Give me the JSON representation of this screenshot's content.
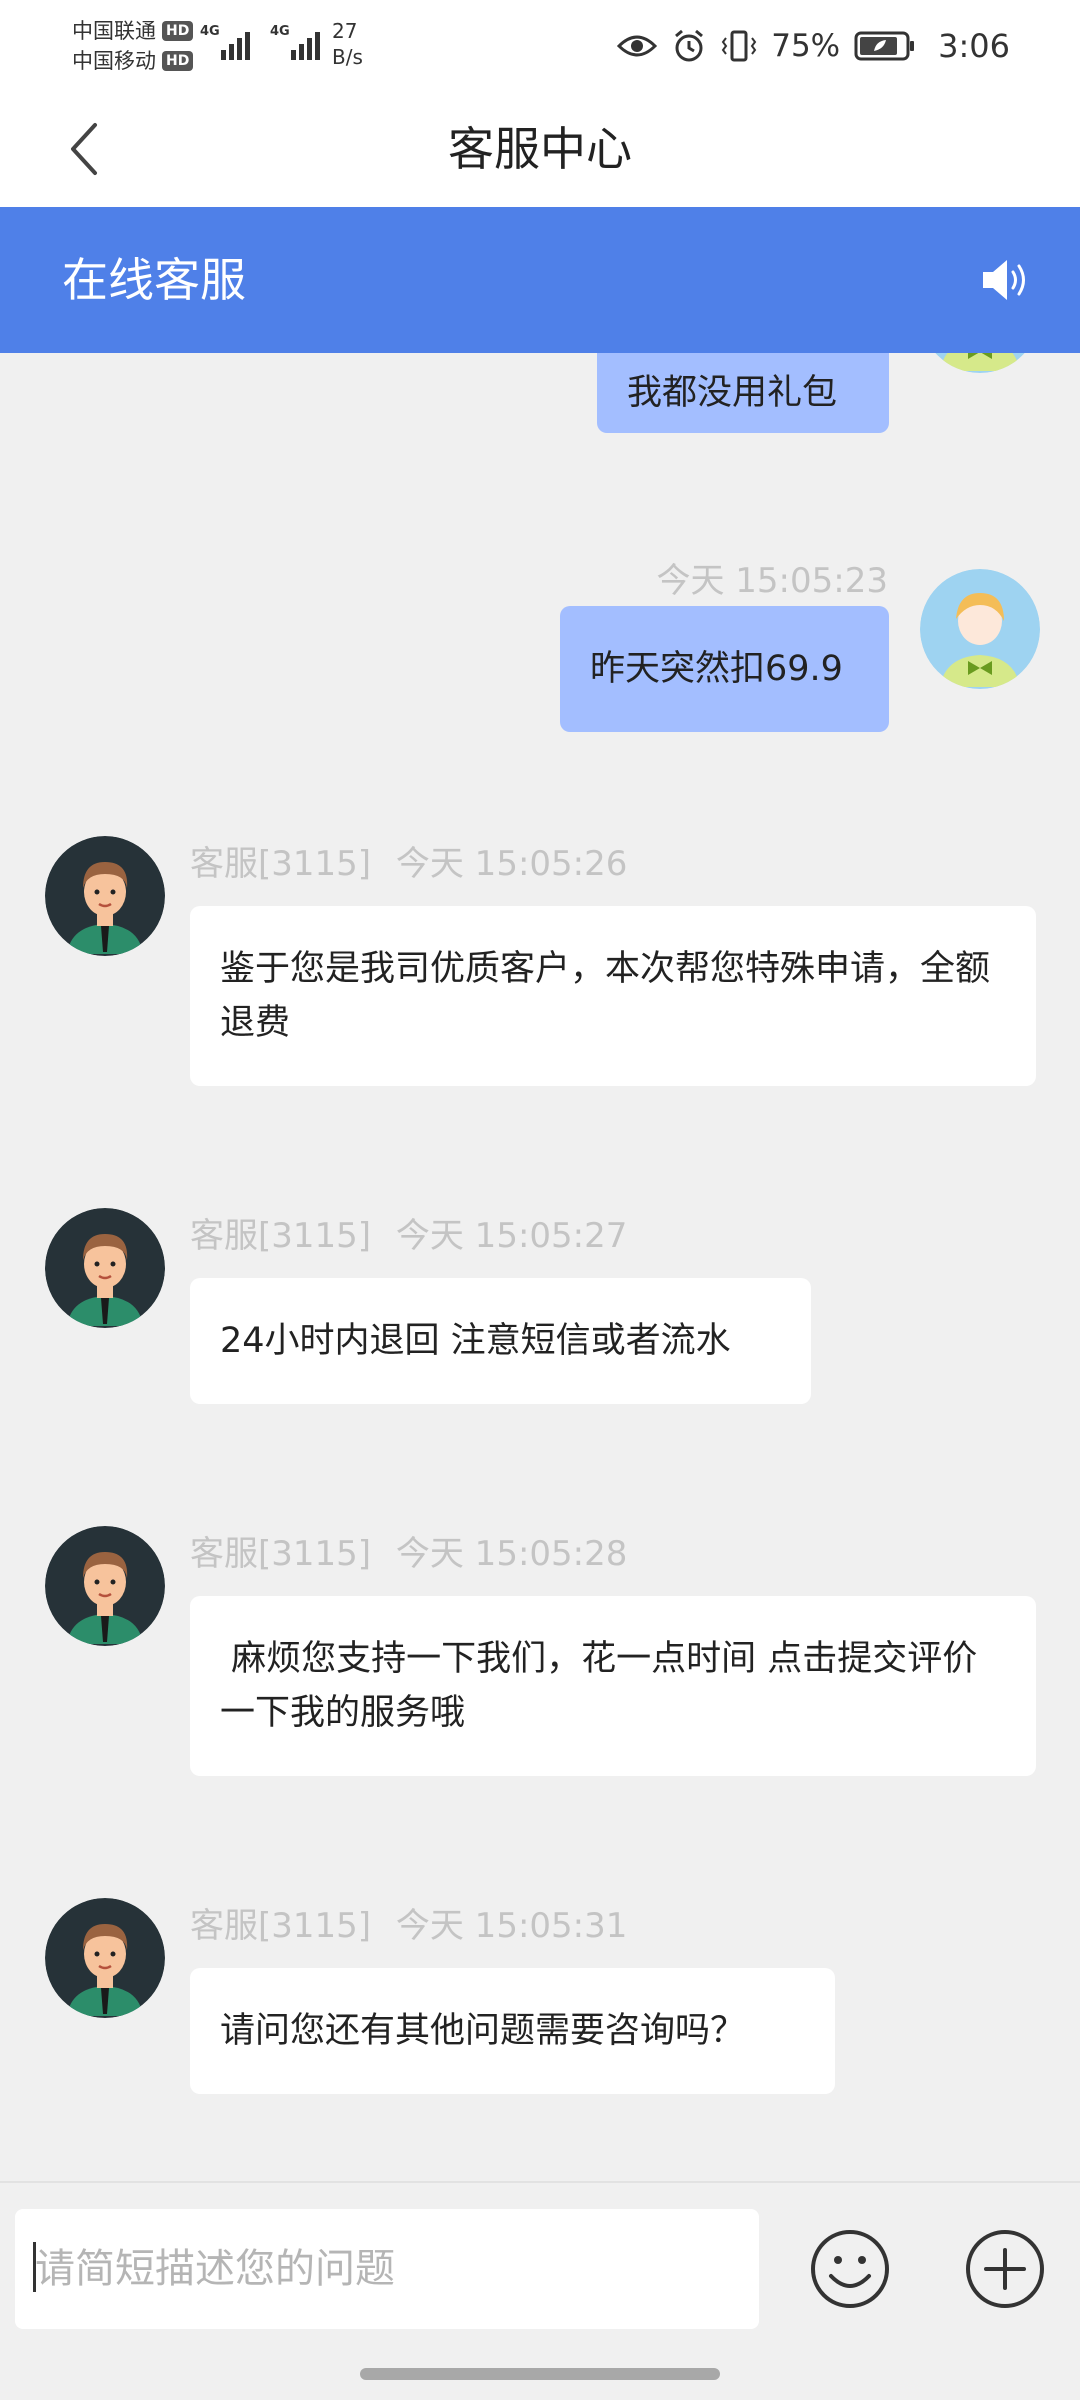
{
  "status_bar": {
    "carrier1": "中国联通",
    "carrier2": "中国移动",
    "hd": "HD",
    "network1": "4G",
    "network2": "4G",
    "speed_value": "27",
    "speed_unit": "B/s",
    "battery_percent": "75%",
    "time": "3:06"
  },
  "title_bar": {
    "title": "客服中心"
  },
  "service_header": {
    "title": "在线客服"
  },
  "messages": [
    {
      "sender": "user",
      "text": "我都没用礼包",
      "meta": ""
    },
    {
      "sender": "user",
      "text": "昨天突然扣69.9",
      "meta": "今天 15:05:23"
    },
    {
      "sender": "agent",
      "agent": "客服[3115]",
      "time": "今天 15:05:26",
      "text": "鉴于您是我司优质客户，本次帮您特殊申请，全额退费"
    },
    {
      "sender": "agent",
      "agent": "客服[3115]",
      "time": "今天 15:05:27",
      "text": "24小时内退回 注意短信或者流水"
    },
    {
      "sender": "agent",
      "agent": "客服[3115]",
      "time": "今天 15:05:28",
      "text": " 麻烦您支持一下我们，花一点时间 点击提交评价一下我的服务哦"
    },
    {
      "sender": "agent",
      "agent": "客服[3115]",
      "time": "今天 15:05:31",
      "text": "请问您还有其他问题需要咨询吗？"
    }
  ],
  "input": {
    "placeholder": "请简短描述您的问题"
  },
  "colors": {
    "header_blue": "#4f80e8",
    "user_bubble": "#a3beff",
    "agent_bubble": "#ffffff",
    "background": "#f0f0f0"
  },
  "icons": {
    "back": "back-arrow-icon",
    "sound": "speaker-icon",
    "emoji": "smiley-icon",
    "plus": "plus-circle-icon"
  }
}
